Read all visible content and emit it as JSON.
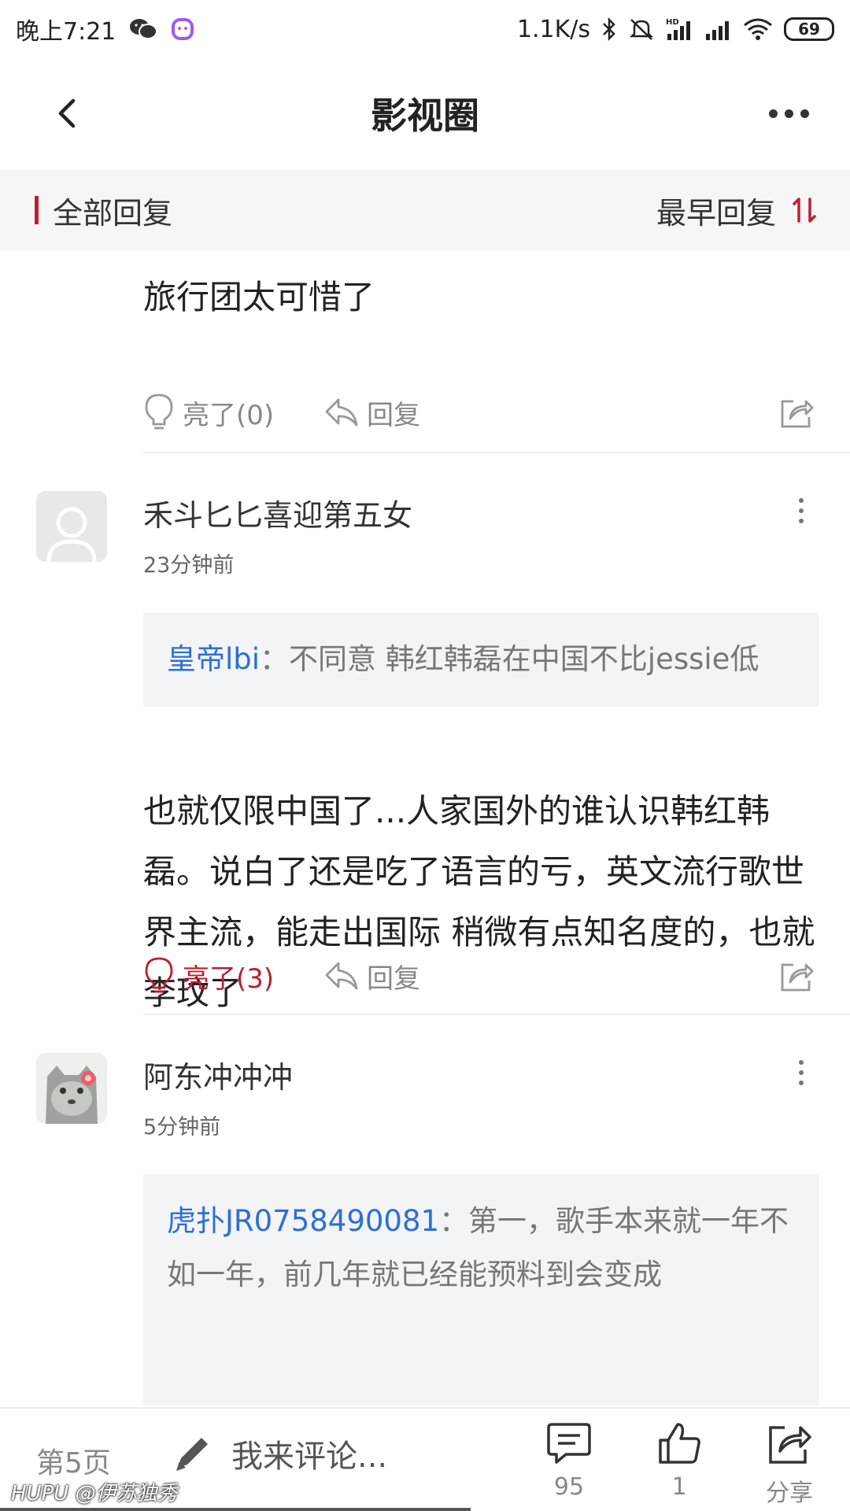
{
  "status_bar": {
    "time": "晚上7:21",
    "network_speed": "1.1K/s",
    "battery": "69",
    "icons": [
      "wechat-icon",
      "soul-app-icon",
      "bluetooth-icon",
      "mute-icon",
      "hd-signal-icon",
      "signal-icon",
      "wifi-icon",
      "battery-icon"
    ]
  },
  "header": {
    "title": "影视圈",
    "back_icon": "chevron-left-icon",
    "more_icon": "more-horizontal-icon"
  },
  "sort_bar": {
    "label": "全部回复",
    "order": "最早回复",
    "accent": "#c01e2f"
  },
  "replies": [
    {
      "content": "旅行团太可惜了",
      "light_label": "亮了(0)",
      "reply_label": "回复",
      "lit": false
    },
    {
      "username": "禾斗匕匕喜迎第五女",
      "time": "23分钟前",
      "quote_user": "皇帝lbi",
      "quote_sep": "：",
      "quote_text": "不同意 韩红韩磊在中国不比jessie低",
      "content": "也就仅限中国了...人家国外的谁认识韩红韩磊。说白了还是吃了语言的亏，英文流行歌世界主流，能走出国际 稍微有点知名度的，也就李玟了",
      "light_label": "亮了(3)",
      "reply_label": "回复",
      "lit": true
    },
    {
      "username": "阿东冲冲冲",
      "time": "5分钟前",
      "quote_user": "虎扑JR0758490081",
      "quote_sep": "：",
      "quote_text": "第一，歌手本来就一年不如一年，前几年就已经能预料到会变成"
    }
  ],
  "bottom_bar": {
    "page": "第5页",
    "comment_placeholder": "我来评论...",
    "comment_count": "95",
    "like_count": "1",
    "share_label": "分享"
  },
  "watermark": {
    "brand": "HUPU",
    "author": "@伊苏独秀"
  },
  "colors": {
    "accent_red": "#b8202e",
    "link_blue": "#2c6fd6",
    "muted": "#888888"
  }
}
